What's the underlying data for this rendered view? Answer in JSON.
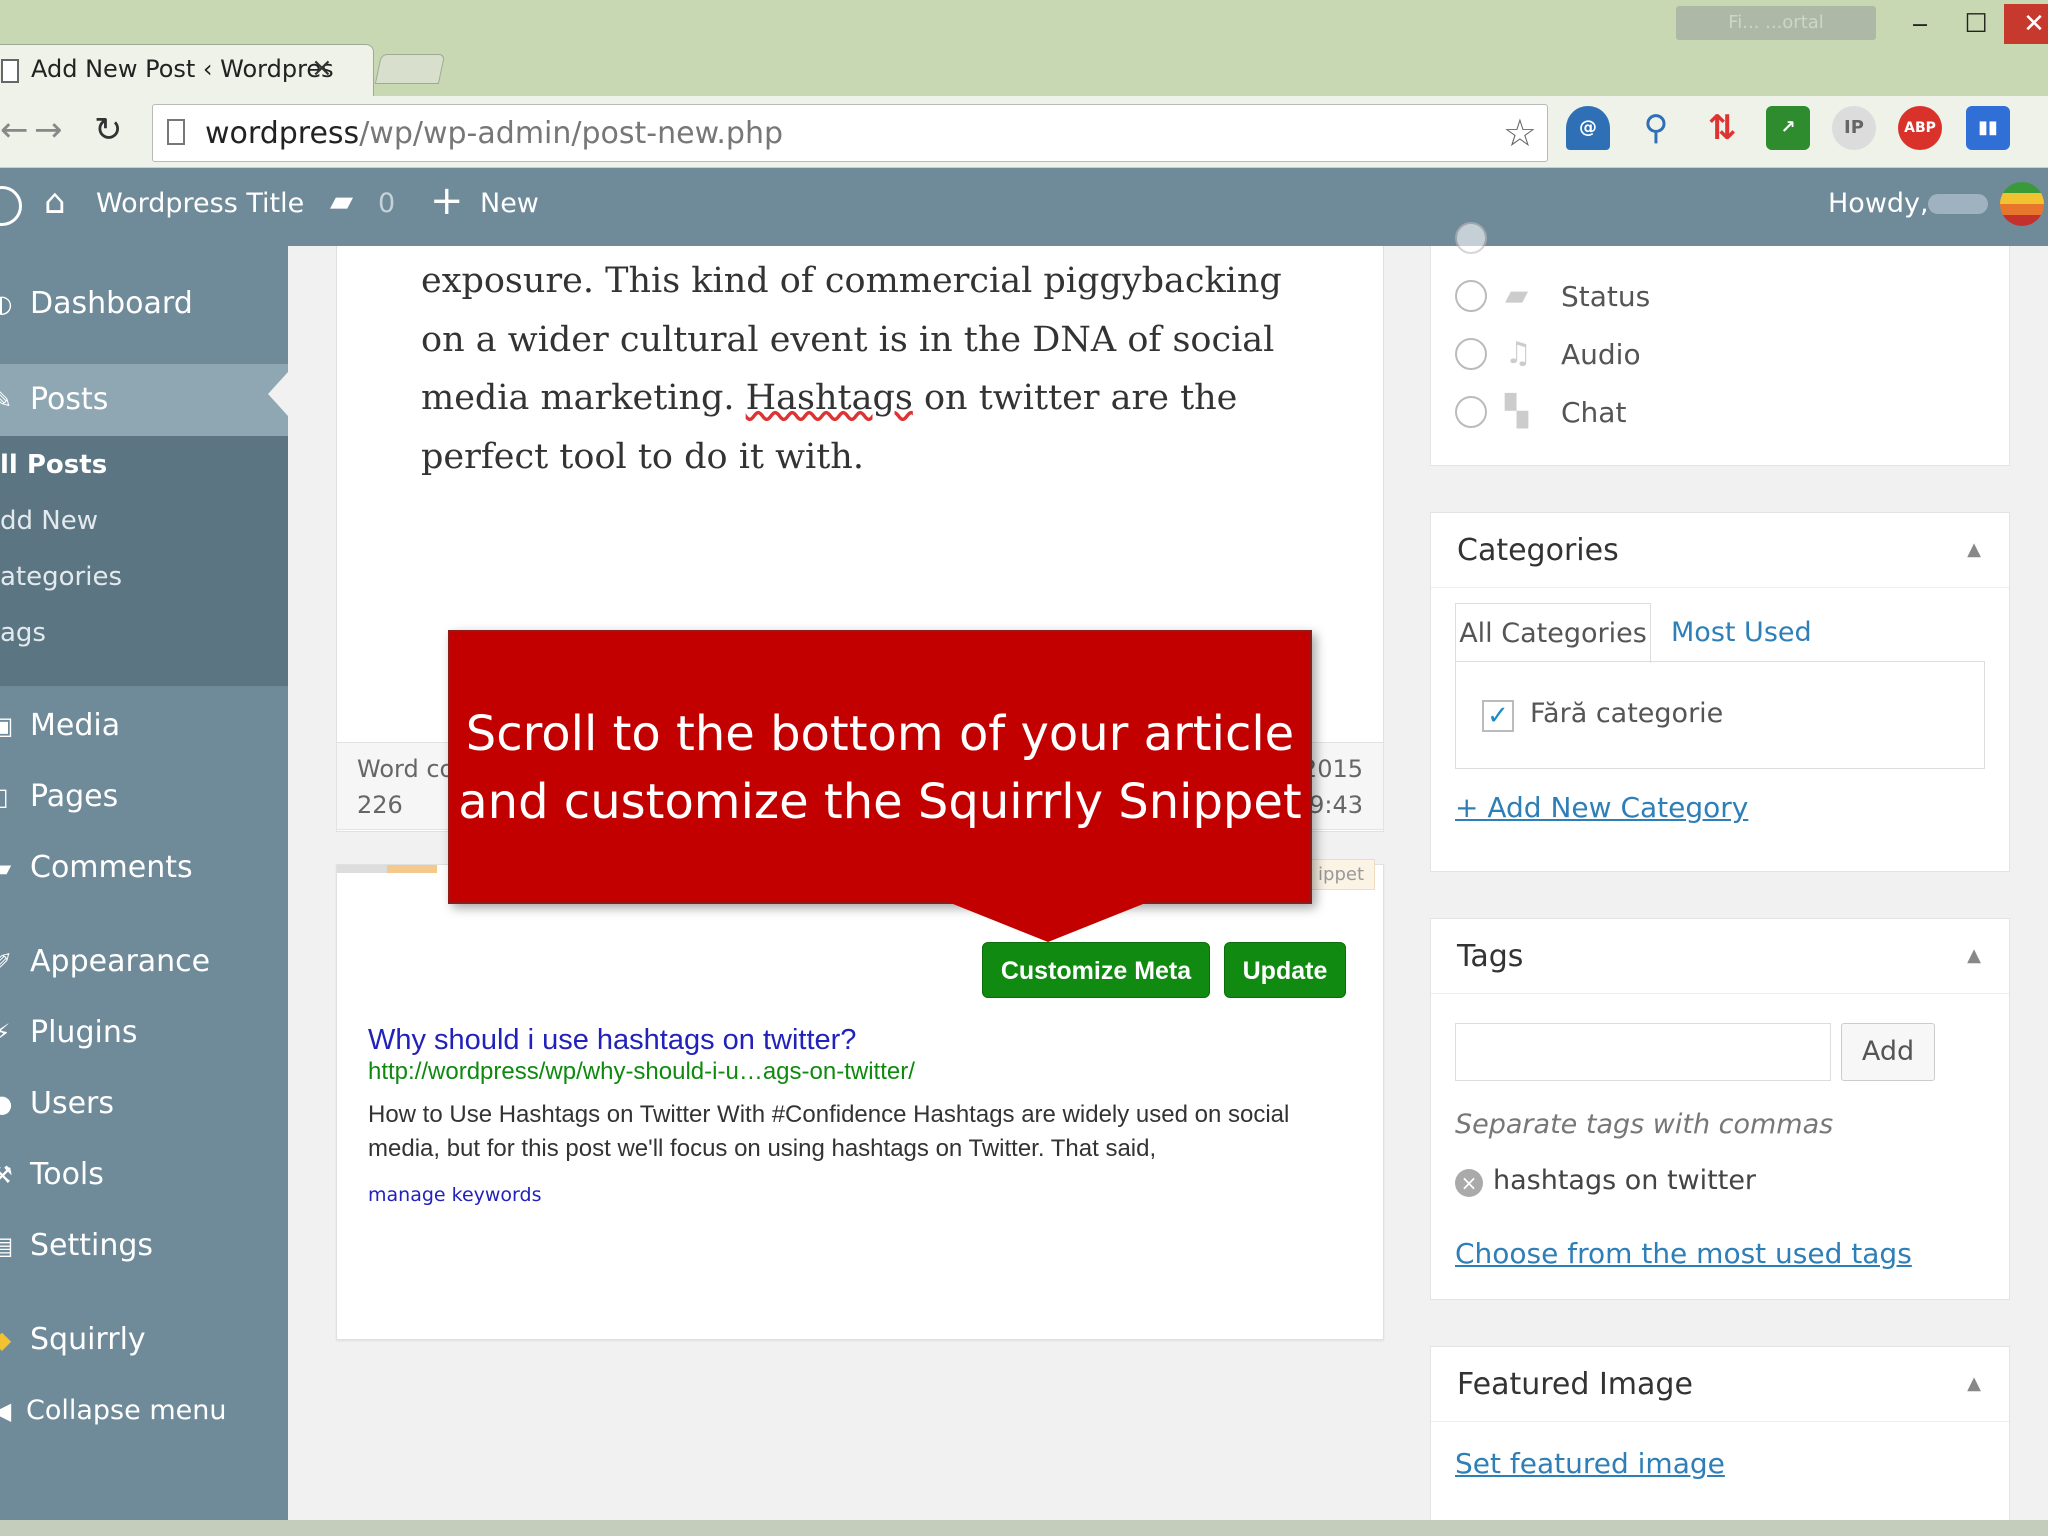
{
  "browser": {
    "tab_title": "Add New Post ‹ Wordpres",
    "tab_close": "×",
    "url_host": "wordpress",
    "url_path": "/wp/wp-admin/post-new.php",
    "window_title_blurred": "Fi... ...ortal"
  },
  "adminbar": {
    "site_title": "Wordpress Title",
    "comment_count": "0",
    "new_label": "New",
    "howdy": "Howdy,"
  },
  "sidebar": {
    "items": [
      {
        "label": "Dashboard"
      },
      {
        "label": "Posts"
      },
      {
        "label": "Media"
      },
      {
        "label": "Pages"
      },
      {
        "label": "Comments"
      },
      {
        "label": "Appearance"
      },
      {
        "label": "Plugins"
      },
      {
        "label": "Users"
      },
      {
        "label": "Tools"
      },
      {
        "label": "Settings"
      },
      {
        "label": "Squirrly"
      },
      {
        "label": "Collapse menu"
      }
    ],
    "submenu": [
      "ll Posts",
      "dd New",
      "ategories",
      "ags"
    ]
  },
  "editor": {
    "text_before": "exposure. This kind of commercial piggybacking on a wider cultural event is in the DNA of social media marketing. ",
    "text_spell": "Hashtags",
    "text_after": " on twitter are the perfect tool to do it with.",
    "word_count_label": "Word co",
    "word_count_value": "226",
    "last_edit_1": "2015",
    "last_edit_2": "9:43"
  },
  "snippet": {
    "tab_label": "ippet",
    "customize_button": "Customize Meta",
    "update_button": "Update",
    "title": "Why should i use hashtags on twitter?",
    "url": "http://wordpress/wp/why-should-i-u…ags-on-twitter/",
    "description": "How to Use Hashtags on Twitter With #Confidence Hashtags are widely used on social media, but for this post we'll focus on using hashtags on Twitter. That said,",
    "manage_keywords": "manage keywords"
  },
  "format_panel": {
    "options": [
      {
        "label": "Status"
      },
      {
        "label": "Audio"
      },
      {
        "label": "Chat"
      }
    ]
  },
  "categories_panel": {
    "title": "Categories",
    "tab_all": "All Categories",
    "tab_most": "Most Used",
    "category": "Fără categorie",
    "add_new": "+ Add New Category"
  },
  "tags_panel": {
    "title": "Tags",
    "add_button": "Add",
    "hint": "Separate tags with commas",
    "tag": "hashtags on twitter",
    "choose": "Choose from the most used tags"
  },
  "featured_panel": {
    "title": "Featured Image",
    "link": "Set featured image"
  },
  "callout": {
    "line1": "Scroll to the bottom of your article",
    "line2": "and customize the Squirrly Snippet"
  },
  "colors": {
    "admin_bar": "#6f8a99",
    "callout": "#c30000",
    "green_button": "#108a10",
    "link": "#2e7fb8"
  }
}
